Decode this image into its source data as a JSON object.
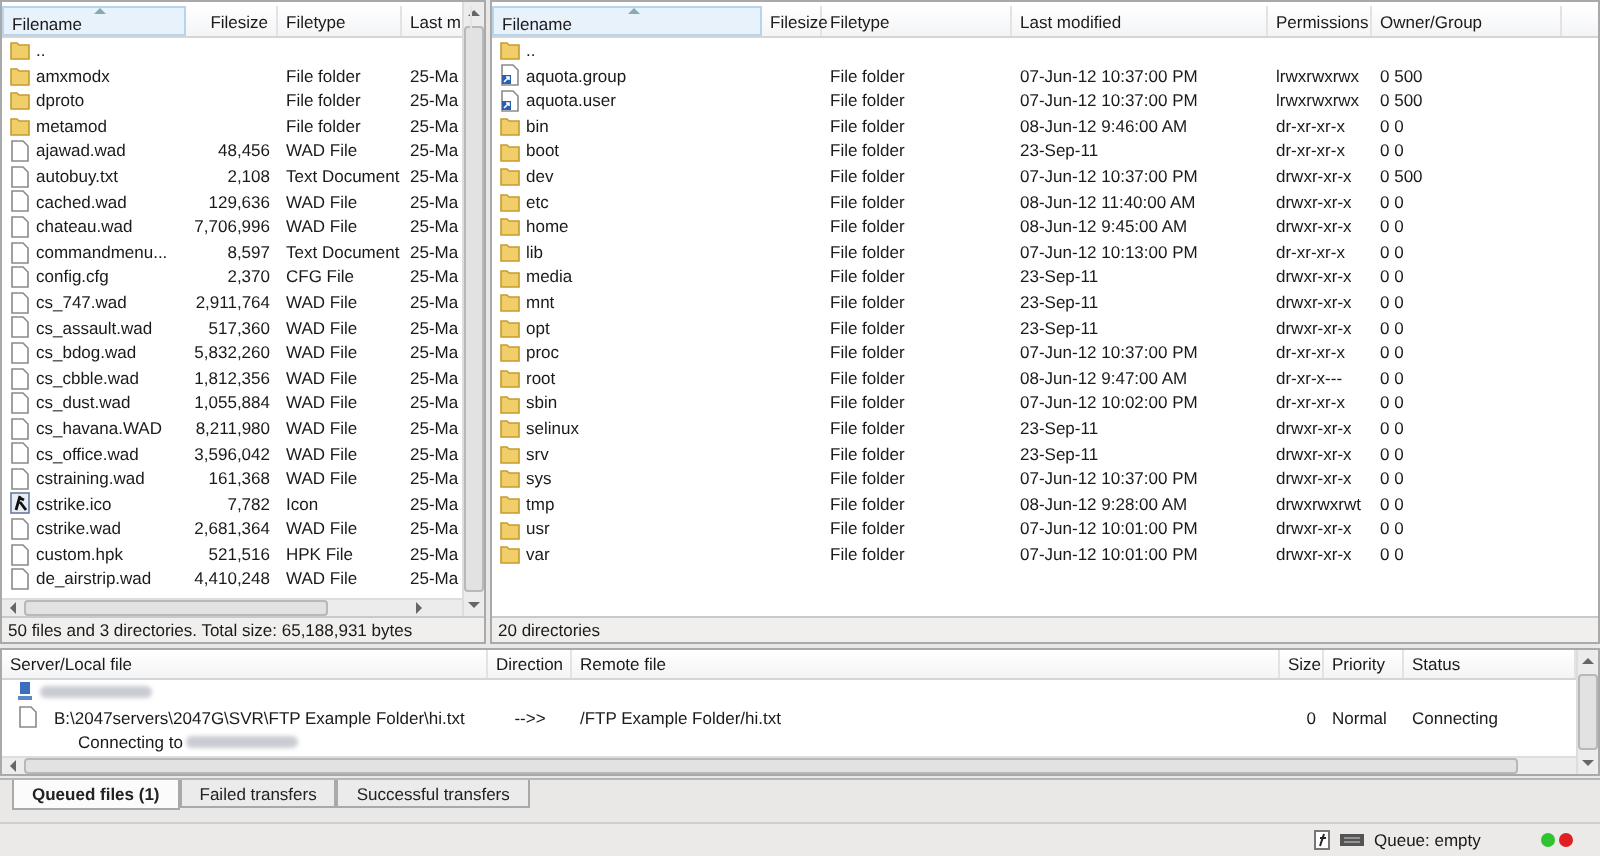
{
  "local": {
    "columns": [
      "Filename",
      "Filesize",
      "Filetype",
      "Last m"
    ],
    "rows": [
      {
        "kind": "folder",
        "name": ".."
      },
      {
        "kind": "folder",
        "name": "amxmodx",
        "type": "File folder",
        "modified": "25-Ma"
      },
      {
        "kind": "folder",
        "name": "dproto",
        "type": "File folder",
        "modified": "25-Ma"
      },
      {
        "kind": "folder",
        "name": "metamod",
        "type": "File folder",
        "modified": "25-Ma"
      },
      {
        "kind": "file",
        "name": "ajawad.wad",
        "size": "48,456",
        "type": "WAD File",
        "modified": "25-Ma"
      },
      {
        "kind": "file",
        "name": "autobuy.txt",
        "size": "2,108",
        "type": "Text Document",
        "modified": "25-Ma"
      },
      {
        "kind": "file",
        "name": "cached.wad",
        "size": "129,636",
        "type": "WAD File",
        "modified": "25-Ma"
      },
      {
        "kind": "file",
        "name": "chateau.wad",
        "size": "7,706,996",
        "type": "WAD File",
        "modified": "25-Ma"
      },
      {
        "kind": "file",
        "name": "commandmenu...",
        "size": "8,597",
        "type": "Text Document",
        "modified": "25-Ma"
      },
      {
        "kind": "file",
        "name": "config.cfg",
        "size": "2,370",
        "type": "CFG File",
        "modified": "25-Ma"
      },
      {
        "kind": "file",
        "name": "cs_747.wad",
        "size": "2,911,764",
        "type": "WAD File",
        "modified": "25-Ma"
      },
      {
        "kind": "file",
        "name": "cs_assault.wad",
        "size": "517,360",
        "type": "WAD File",
        "modified": "25-Ma"
      },
      {
        "kind": "file",
        "name": "cs_bdog.wad",
        "size": "5,832,260",
        "type": "WAD File",
        "modified": "25-Ma"
      },
      {
        "kind": "file",
        "name": "cs_cbble.wad",
        "size": "1,812,356",
        "type": "WAD File",
        "modified": "25-Ma"
      },
      {
        "kind": "file",
        "name": "cs_dust.wad",
        "size": "1,055,884",
        "type": "WAD File",
        "modified": "25-Ma"
      },
      {
        "kind": "file",
        "name": "cs_havana.WAD",
        "size": "8,211,980",
        "type": "WAD File",
        "modified": "25-Ma"
      },
      {
        "kind": "file",
        "name": "cs_office.wad",
        "size": "3,596,042",
        "type": "WAD File",
        "modified": "25-Ma"
      },
      {
        "kind": "file",
        "name": "cstraining.wad",
        "size": "161,368",
        "type": "WAD File",
        "modified": "25-Ma"
      },
      {
        "kind": "icon",
        "name": "cstrike.ico",
        "size": "7,782",
        "type": "Icon",
        "modified": "25-Ma"
      },
      {
        "kind": "file",
        "name": "cstrike.wad",
        "size": "2,681,364",
        "type": "WAD File",
        "modified": "25-Ma"
      },
      {
        "kind": "file",
        "name": "custom.hpk",
        "size": "521,516",
        "type": "HPK File",
        "modified": "25-Ma"
      },
      {
        "kind": "file",
        "name": "de_airstrip.wad",
        "size": "4,410,248",
        "type": "WAD File",
        "modified": "25-Ma"
      }
    ],
    "status": "50 files and 3 directories. Total size: 65,188,931 bytes"
  },
  "remote": {
    "columns": [
      "Filename",
      "Filesize",
      "Filetype",
      "Last modified",
      "Permissions",
      "Owner/Group"
    ],
    "rows": [
      {
        "kind": "folder",
        "name": ".."
      },
      {
        "kind": "link",
        "name": "aquota.group",
        "type": "File folder",
        "modified": "07-Jun-12 10:37:00 PM",
        "permissions": "lrwxrwxrwx",
        "owner": "0 500"
      },
      {
        "kind": "link",
        "name": "aquota.user",
        "type": "File folder",
        "modified": "07-Jun-12 10:37:00 PM",
        "permissions": "lrwxrwxrwx",
        "owner": "0 500"
      },
      {
        "kind": "folder",
        "name": "bin",
        "type": "File folder",
        "modified": "08-Jun-12 9:46:00 AM",
        "permissions": "dr-xr-xr-x",
        "owner": "0 0"
      },
      {
        "kind": "folder",
        "name": "boot",
        "type": "File folder",
        "modified": "23-Sep-11",
        "permissions": "dr-xr-xr-x",
        "owner": "0 0"
      },
      {
        "kind": "folder",
        "name": "dev",
        "type": "File folder",
        "modified": "07-Jun-12 10:37:00 PM",
        "permissions": "drwxr-xr-x",
        "owner": "0 500"
      },
      {
        "kind": "folder",
        "name": "etc",
        "type": "File folder",
        "modified": "08-Jun-12 11:40:00 AM",
        "permissions": "drwxr-xr-x",
        "owner": "0 0"
      },
      {
        "kind": "folder",
        "name": "home",
        "type": "File folder",
        "modified": "08-Jun-12 9:45:00 AM",
        "permissions": "drwxr-xr-x",
        "owner": "0 0"
      },
      {
        "kind": "folder",
        "name": "lib",
        "type": "File folder",
        "modified": "07-Jun-12 10:13:00 PM",
        "permissions": "dr-xr-xr-x",
        "owner": "0 0"
      },
      {
        "kind": "folder",
        "name": "media",
        "type": "File folder",
        "modified": "23-Sep-11",
        "permissions": "drwxr-xr-x",
        "owner": "0 0"
      },
      {
        "kind": "folder",
        "name": "mnt",
        "type": "File folder",
        "modified": "23-Sep-11",
        "permissions": "drwxr-xr-x",
        "owner": "0 0"
      },
      {
        "kind": "folder",
        "name": "opt",
        "type": "File folder",
        "modified": "23-Sep-11",
        "permissions": "drwxr-xr-x",
        "owner": "0 0"
      },
      {
        "kind": "folder",
        "name": "proc",
        "type": "File folder",
        "modified": "07-Jun-12 10:37:00 PM",
        "permissions": "dr-xr-xr-x",
        "owner": "0 0"
      },
      {
        "kind": "folder",
        "name": "root",
        "type": "File folder",
        "modified": "08-Jun-12 9:47:00 AM",
        "permissions": "dr-xr-x---",
        "owner": "0 0"
      },
      {
        "kind": "folder",
        "name": "sbin",
        "type": "File folder",
        "modified": "07-Jun-12 10:02:00 PM",
        "permissions": "dr-xr-xr-x",
        "owner": "0 0"
      },
      {
        "kind": "folder",
        "name": "selinux",
        "type": "File folder",
        "modified": "23-Sep-11",
        "permissions": "drwxr-xr-x",
        "owner": "0 0"
      },
      {
        "kind": "folder",
        "name": "srv",
        "type": "File folder",
        "modified": "23-Sep-11",
        "permissions": "drwxr-xr-x",
        "owner": "0 0"
      },
      {
        "kind": "folder",
        "name": "sys",
        "type": "File folder",
        "modified": "07-Jun-12 10:37:00 PM",
        "permissions": "drwxr-xr-x",
        "owner": "0 0"
      },
      {
        "kind": "folder",
        "name": "tmp",
        "type": "File folder",
        "modified": "08-Jun-12 9:28:00 AM",
        "permissions": "drwxrwxrwt",
        "owner": "0 0"
      },
      {
        "kind": "folder",
        "name": "usr",
        "type": "File folder",
        "modified": "07-Jun-12 10:01:00 PM",
        "permissions": "drwxr-xr-x",
        "owner": "0 0"
      },
      {
        "kind": "folder",
        "name": "var",
        "type": "File folder",
        "modified": "07-Jun-12 10:01:00 PM",
        "permissions": "drwxr-xr-x",
        "owner": "0 0"
      }
    ],
    "status": "20 directories"
  },
  "queue": {
    "columns": [
      "Server/Local file",
      "Direction",
      "Remote file",
      "Size",
      "Priority",
      "Status"
    ],
    "items": [
      {
        "local": "B:\\2047servers\\2047G\\SVR\\FTP Example Folder\\hi.txt",
        "direction": "-->>",
        "remote": "/FTP Example Folder/hi.txt",
        "size": "0",
        "priority": "Normal",
        "status": "Connecting"
      }
    ],
    "connecting": "Connecting to"
  },
  "queue_tabs": [
    {
      "label": "Queued files (1)",
      "selected": true
    },
    {
      "label": "Failed transfers",
      "selected": false
    },
    {
      "label": "Successful transfers",
      "selected": false
    }
  ],
  "status_bar": {
    "queue": "Queue: empty"
  }
}
